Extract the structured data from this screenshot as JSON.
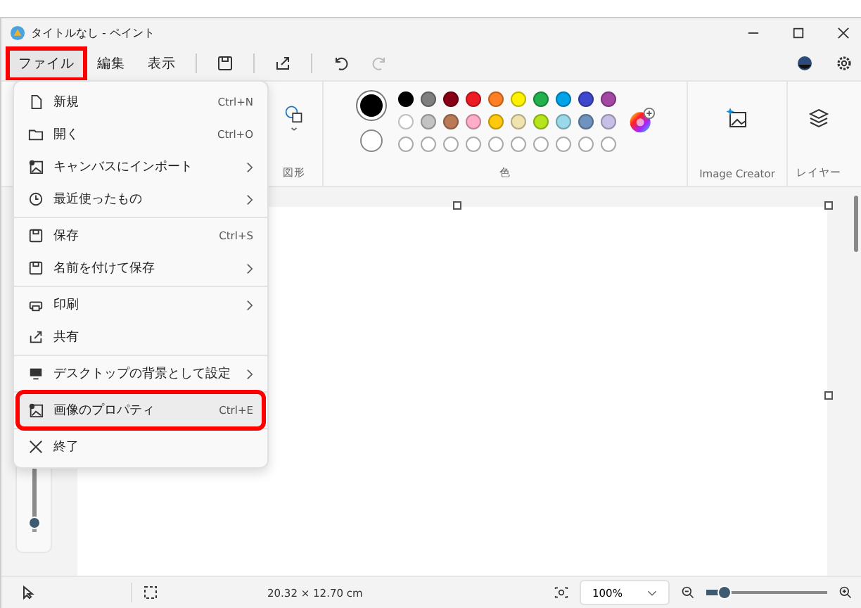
{
  "window": {
    "title": "タイトルなし - ペイント"
  },
  "menubar": [
    {
      "label": "ファイル",
      "selected": true,
      "highlighted": true
    },
    {
      "label": "編集",
      "selected": false,
      "highlighted": false
    },
    {
      "label": "表示",
      "selected": false,
      "highlighted": false
    }
  ],
  "file_menu": [
    {
      "kind": "item",
      "label": "新規",
      "shortcut": "Ctrl+N",
      "submenu": false,
      "selected": false,
      "highlighted": false
    },
    {
      "kind": "item",
      "label": "開く",
      "shortcut": "Ctrl+O",
      "submenu": false,
      "selected": false,
      "highlighted": false
    },
    {
      "kind": "item",
      "label": "キャンバスにインポート",
      "submenu": true,
      "selected": false,
      "highlighted": false
    },
    {
      "kind": "item",
      "label": "最近使ったもの",
      "submenu": true,
      "selected": false,
      "highlighted": false
    },
    {
      "kind": "separator"
    },
    {
      "kind": "item",
      "label": "保存",
      "shortcut": "Ctrl+S",
      "submenu": false,
      "selected": false,
      "highlighted": false
    },
    {
      "kind": "item",
      "label": "名前を付けて保存",
      "submenu": true,
      "selected": false,
      "highlighted": false
    },
    {
      "kind": "separator"
    },
    {
      "kind": "item",
      "label": "印刷",
      "submenu": true,
      "selected": false,
      "highlighted": false
    },
    {
      "kind": "item",
      "label": "共有",
      "submenu": false,
      "selected": false,
      "highlighted": false
    },
    {
      "kind": "separator"
    },
    {
      "kind": "item",
      "label": "デスクトップの背景として設定",
      "submenu": true,
      "selected": false,
      "highlighted": false
    },
    {
      "kind": "separator"
    },
    {
      "kind": "item",
      "label": "画像のプロパティ",
      "shortcut": "Ctrl+E",
      "submenu": false,
      "selected": true,
      "highlighted": true
    },
    {
      "kind": "separator"
    },
    {
      "kind": "item",
      "label": "終了",
      "submenu": false,
      "selected": false,
      "highlighted": false
    }
  ],
  "ribbon": {
    "shapes_label": "図形",
    "colors_label": "色",
    "image_creator_label": "Image Creator",
    "layers_label": "レイヤー",
    "current_colors": [
      {
        "color": "#000000"
      },
      {
        "color": "#ffffff"
      }
    ],
    "palette": [
      {
        "color": "#000000"
      },
      {
        "color": "#7f7f7f"
      },
      {
        "color": "#880015"
      },
      {
        "color": "#ed1c24"
      },
      {
        "color": "#ff7f27"
      },
      {
        "color": "#fff200"
      },
      {
        "color": "#22b14c"
      },
      {
        "color": "#00a2e8"
      },
      {
        "color": "#3f48cc"
      },
      {
        "color": "#a349a4"
      },
      {
        "color": "#ffffff"
      },
      {
        "color": "#c3c3c3"
      },
      {
        "color": "#b97a57"
      },
      {
        "color": "#ffaec9"
      },
      {
        "color": "#ffc90e"
      },
      {
        "color": "#efe4b0"
      },
      {
        "color": "#b5e61d"
      },
      {
        "color": "#99d9ea"
      },
      {
        "color": "#7092be"
      },
      {
        "color": "#c8bfe7"
      }
    ]
  },
  "brush_size": {
    "level": 0.1
  },
  "status_bar": {
    "canvas_size": "20.32 × 12.70 cm",
    "zoom": "100%",
    "zoom_slider": {
      "level": 0.15
    }
  }
}
